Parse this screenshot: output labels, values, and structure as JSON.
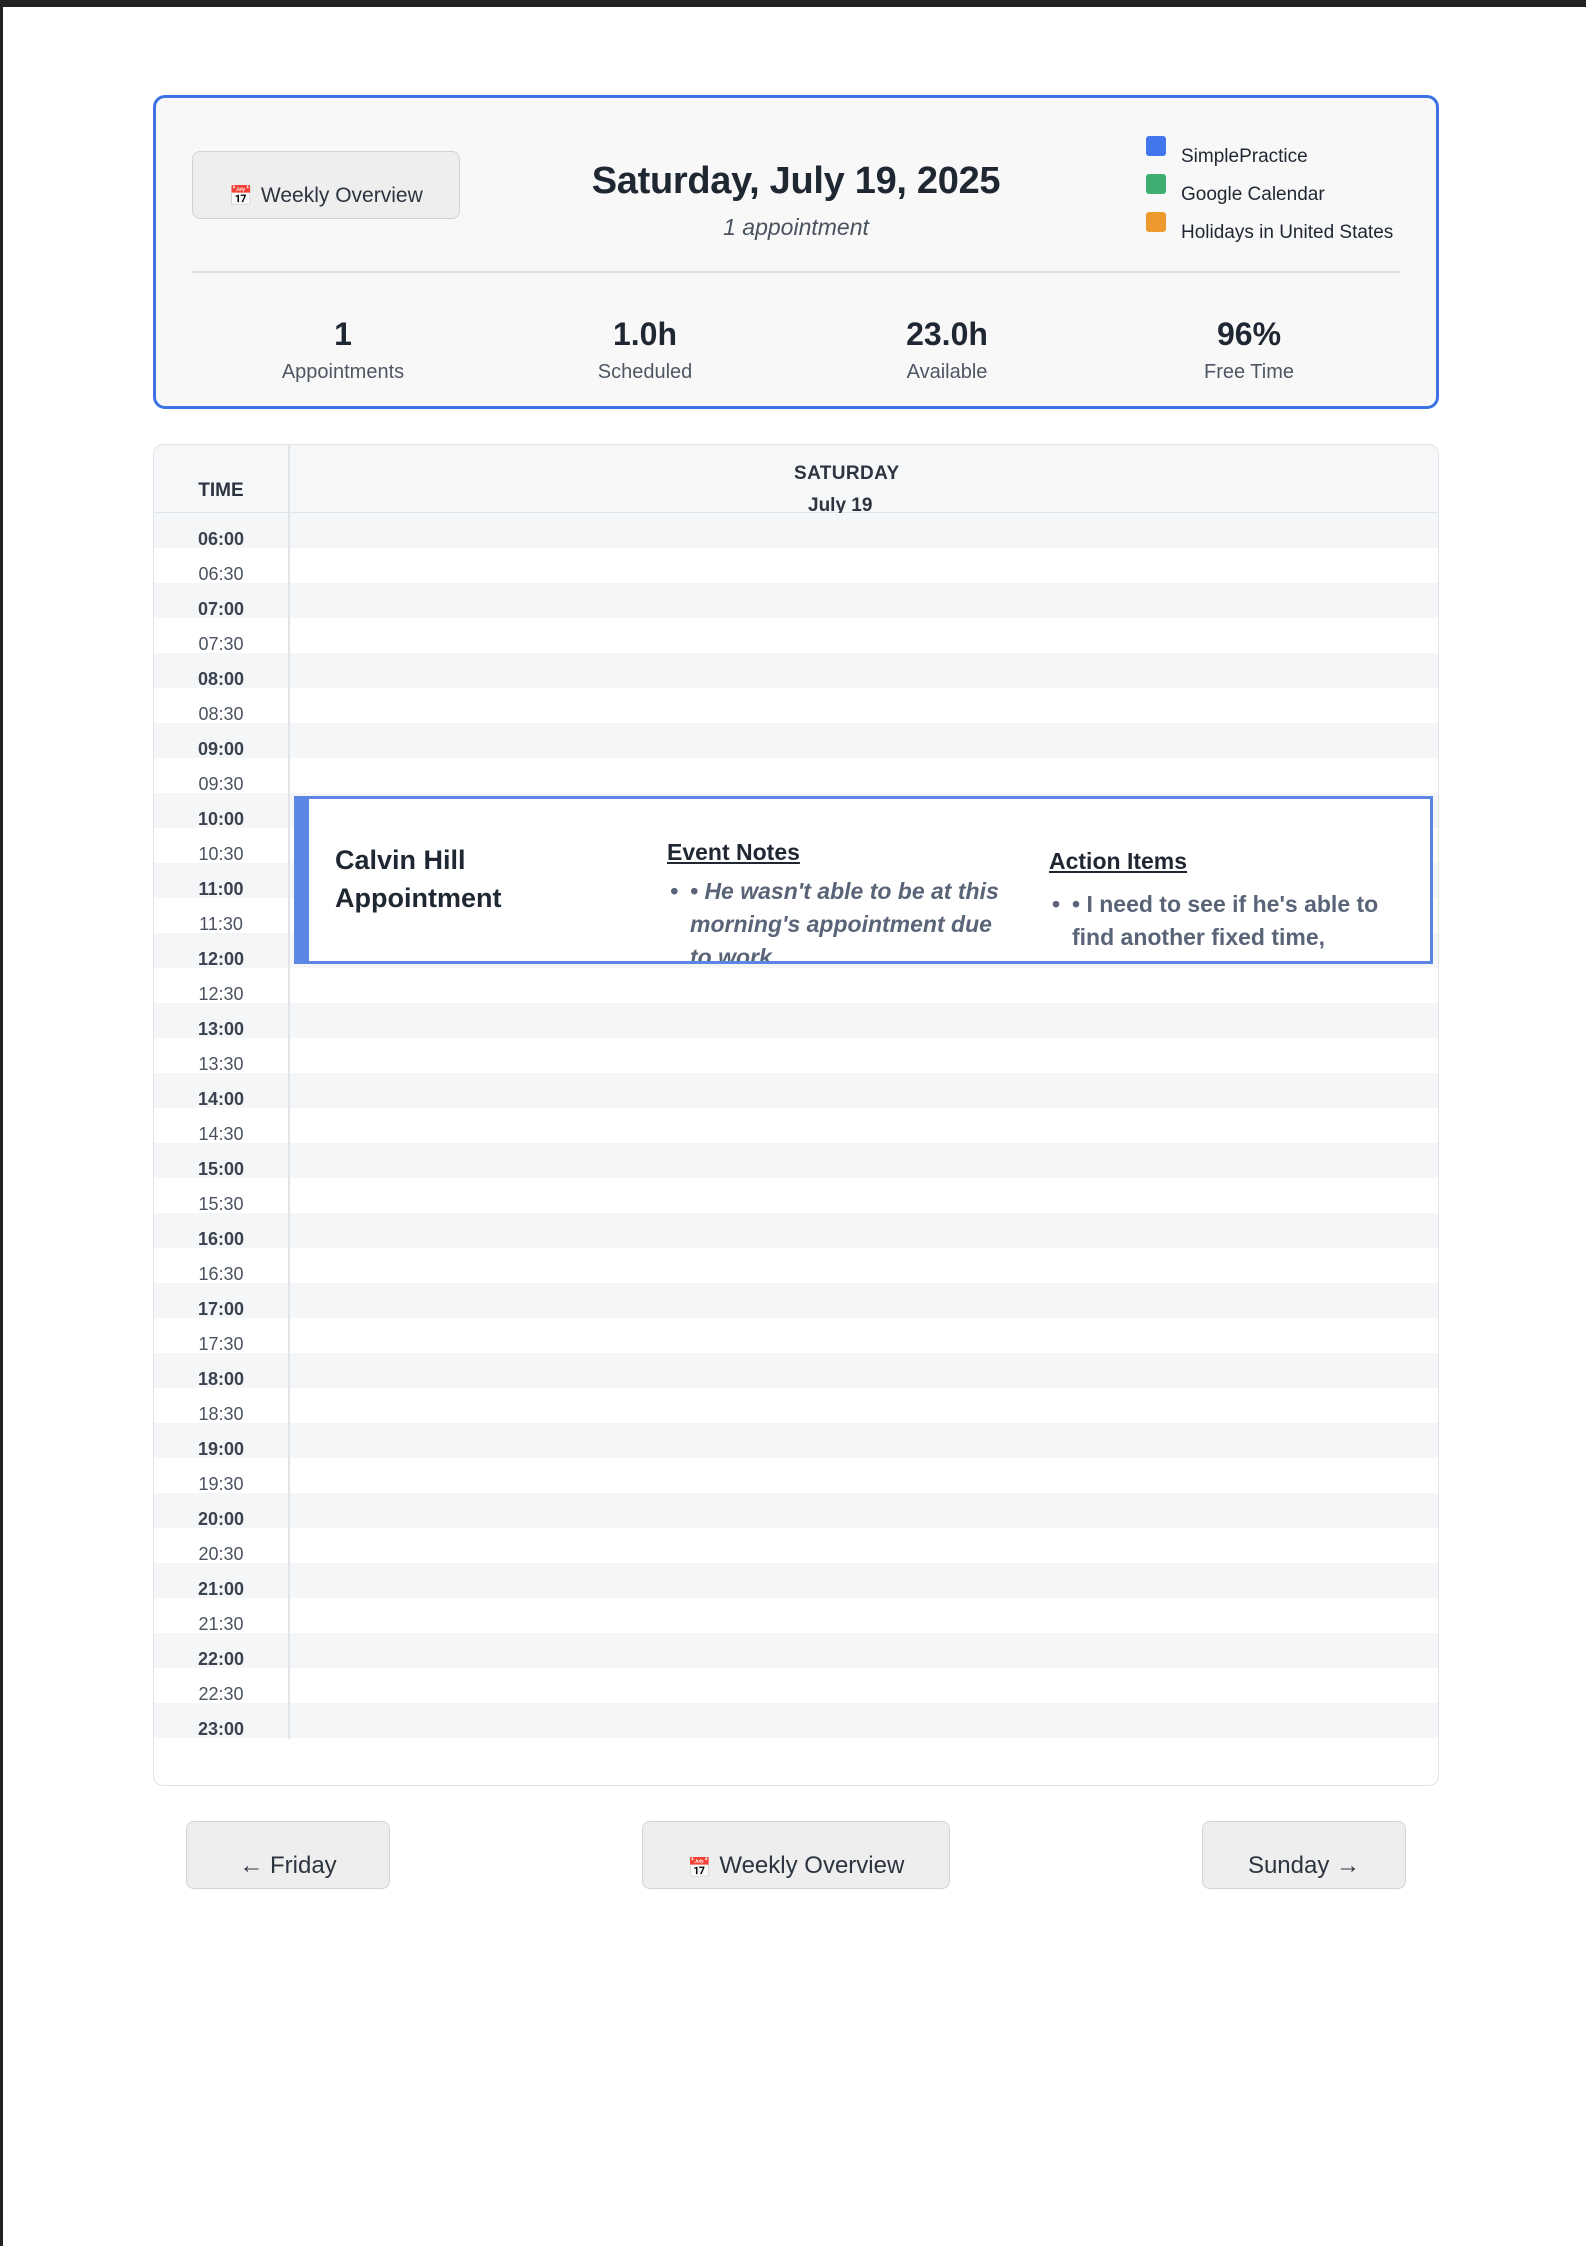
{
  "header": {
    "weekly_button": {
      "icon": "calendar-icon",
      "label": "Weekly Overview"
    },
    "date_title": "Saturday, July 19, 2025",
    "appointment_count": "1 appointment",
    "legend": [
      {
        "label": "SimplePractice",
        "color": "#4177ea"
      },
      {
        "label": "Google Calendar",
        "color": "#3fae72"
      },
      {
        "label": "Holidays in United States",
        "color": "#ec9a2b"
      }
    ],
    "stats": [
      {
        "value": "1",
        "label": "Appointments"
      },
      {
        "value": "1.0h",
        "label": "Scheduled"
      },
      {
        "value": "23.0h",
        "label": "Available"
      },
      {
        "value": "96%",
        "label": "Free Time"
      }
    ]
  },
  "calendar": {
    "time_header": "TIME",
    "day_header": "SATURDAY",
    "day_subheader": "July 19",
    "time_slots": [
      "06:00",
      "06:30",
      "07:00",
      "07:30",
      "08:00",
      "08:30",
      "09:00",
      "09:30",
      "10:00",
      "10:30",
      "11:00",
      "11:30",
      "12:00",
      "12:30",
      "13:00",
      "13:30",
      "14:00",
      "14:30",
      "15:00",
      "15:30",
      "16:00",
      "16:30",
      "17:00",
      "17:30",
      "18:00",
      "18:30",
      "19:00",
      "19:30",
      "20:00",
      "20:30",
      "21:00",
      "21:30",
      "22:00",
      "22:30",
      "23:00"
    ],
    "appointment": {
      "title_line1": "Calvin Hill",
      "title_line2": "Appointment",
      "color": "#5b86e5",
      "notes_heading": "Event Notes",
      "notes_text": "• He wasn't able to be at this morning's appointment due to work",
      "action_heading": "Action Items",
      "action_text": "• I need to see if he's able to find another fixed time,"
    }
  },
  "footer": {
    "prev_label": "← Friday",
    "week_label": "Weekly Overview",
    "week_icon": "calendar-icon",
    "next_label": "Sunday →"
  }
}
